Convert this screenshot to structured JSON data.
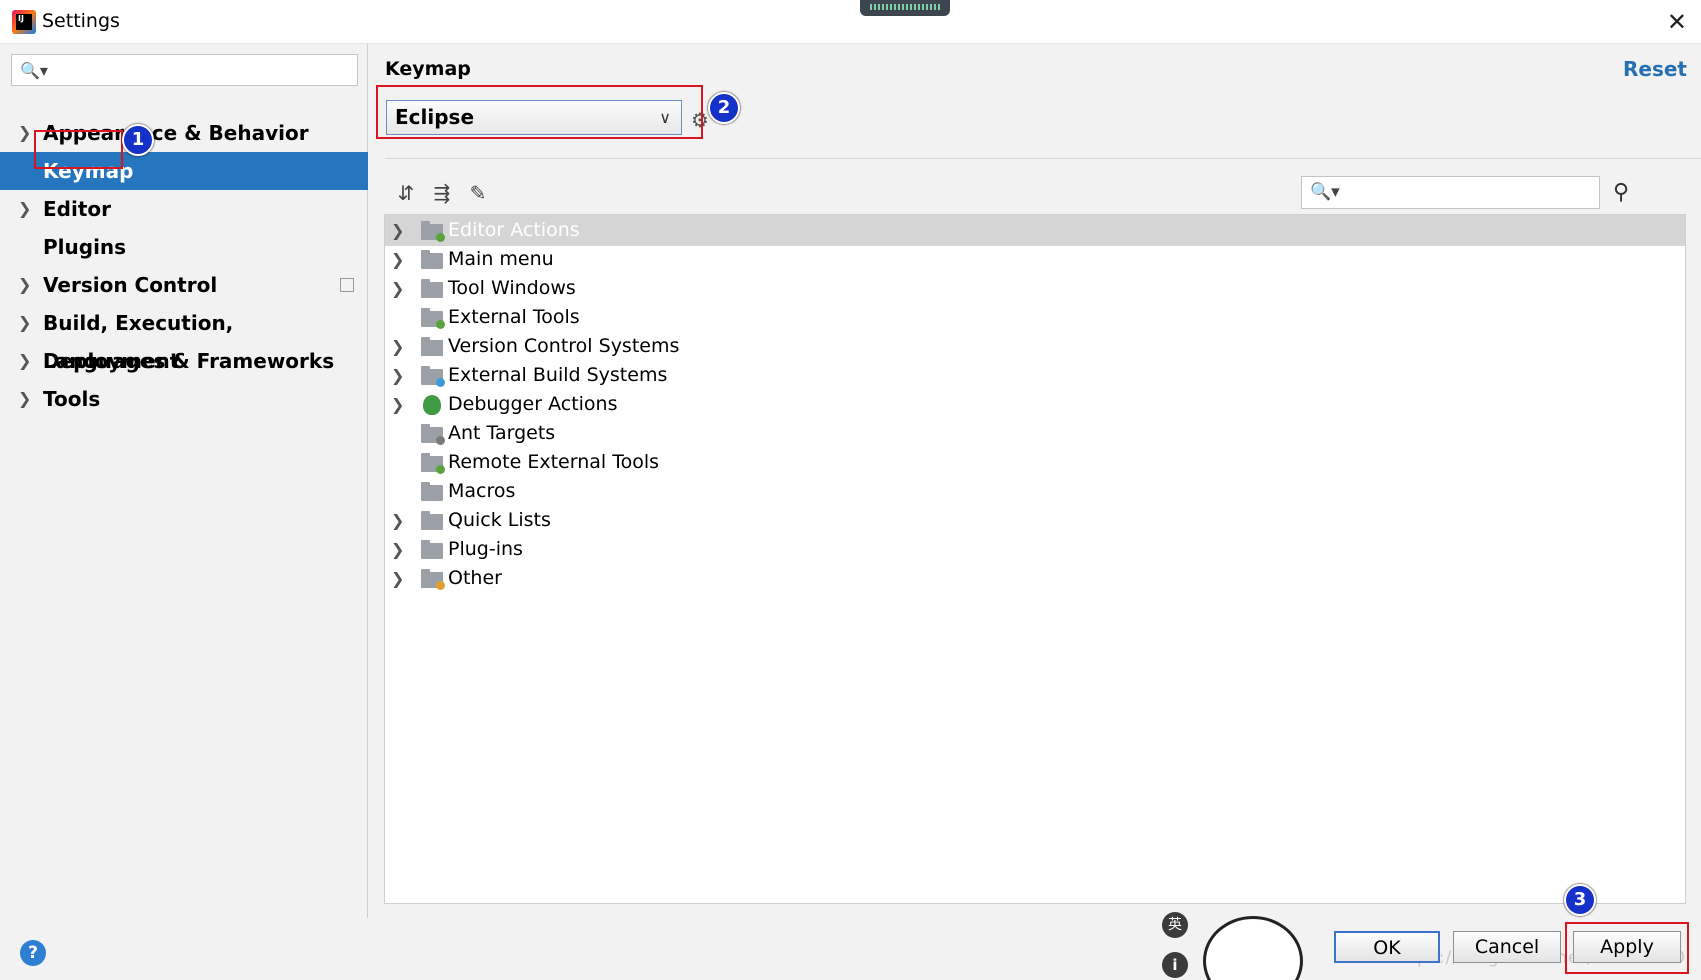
{
  "window": {
    "title": "Settings",
    "close_glyph": "✕"
  },
  "sidebar": {
    "search_placeholder": "",
    "items": [
      {
        "label": "Appearance & Behavior",
        "expandable": true
      },
      {
        "label": "Keymap",
        "expandable": false,
        "selected": true
      },
      {
        "label": "Editor",
        "expandable": true
      },
      {
        "label": "Plugins",
        "expandable": false
      },
      {
        "label": "Version Control",
        "expandable": true
      },
      {
        "label": "Build, Execution, Deployment",
        "expandable": true
      },
      {
        "label": "Languages & Frameworks",
        "expandable": true
      },
      {
        "label": "Tools",
        "expandable": true
      }
    ],
    "help_label": "?"
  },
  "main": {
    "title": "Keymap",
    "reset_label": "Reset",
    "keymap_selected": "Eclipse",
    "filter_placeholder": "",
    "tree": [
      {
        "label": "Editor Actions",
        "expandable": true,
        "selected": true,
        "icon": "editor-actions-icon"
      },
      {
        "label": "Main menu",
        "expandable": true,
        "icon": "main-menu-icon"
      },
      {
        "label": "Tool Windows",
        "expandable": true,
        "icon": "folder-icon"
      },
      {
        "label": "External Tools",
        "expandable": false,
        "icon": "external-tools-icon"
      },
      {
        "label": "Version Control Systems",
        "expandable": true,
        "icon": "folder-icon"
      },
      {
        "label": "External Build Systems",
        "expandable": true,
        "icon": "build-systems-icon"
      },
      {
        "label": "Debugger Actions",
        "expandable": true,
        "icon": "bug-icon"
      },
      {
        "label": "Ant Targets",
        "expandable": false,
        "icon": "ant-icon"
      },
      {
        "label": "Remote External Tools",
        "expandable": false,
        "icon": "remote-tools-icon"
      },
      {
        "label": "Macros",
        "expandable": false,
        "icon": "folder-icon"
      },
      {
        "label": "Quick Lists",
        "expandable": true,
        "icon": "folder-icon"
      },
      {
        "label": "Plug-ins",
        "expandable": true,
        "icon": "folder-icon"
      },
      {
        "label": "Other",
        "expandable": true,
        "icon": "other-icon"
      }
    ]
  },
  "footer": {
    "ok_label": "OK",
    "cancel_label": "Cancel",
    "apply_label": "Apply"
  },
  "annotations": {
    "one": "1",
    "two": "2",
    "three": "3"
  },
  "overlay": {
    "ime_label": "英",
    "info_label": "i",
    "watermark": "https://blog.csdn.net/shenhu00"
  },
  "colors": {
    "selection": "#2675bf",
    "annotation_red": "#d9161d",
    "annotation_blue": "#1431c8",
    "link": "#2470b3"
  }
}
